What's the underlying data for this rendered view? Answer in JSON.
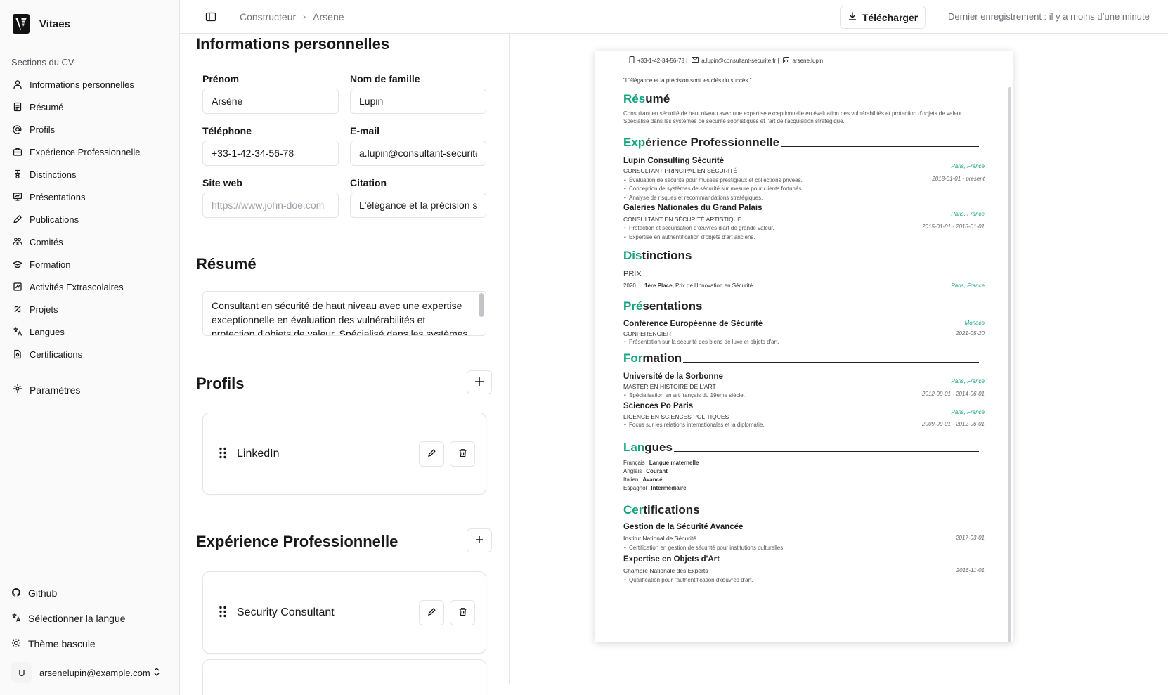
{
  "app": {
    "name": "Vitaes"
  },
  "sidebar": {
    "section_label": "Sections du CV",
    "items": [
      {
        "label": "Informations personnelles",
        "icon": "user-icon"
      },
      {
        "label": "Résumé",
        "icon": "document-icon"
      },
      {
        "label": "Profils",
        "icon": "at-icon"
      },
      {
        "label": "Expérience Professionnelle",
        "icon": "briefcase-icon"
      },
      {
        "label": "Distinctions",
        "icon": "award-icon"
      },
      {
        "label": "Présentations",
        "icon": "presentation-icon"
      },
      {
        "label": "Publications",
        "icon": "pen-icon"
      },
      {
        "label": "Comités",
        "icon": "users-icon"
      },
      {
        "label": "Formation",
        "icon": "graduation-cap-icon"
      },
      {
        "label": "Activités Extrascolaires",
        "icon": "activity-icon"
      },
      {
        "label": "Projets",
        "icon": "projects-icon"
      },
      {
        "label": "Langues",
        "icon": "languages-icon"
      },
      {
        "label": "Certifications",
        "icon": "certificate-icon"
      }
    ],
    "settings_label": "Paramètres",
    "github_label": "Github",
    "language_label": "Sélectionner la langue",
    "theme_label": "Thème bascule",
    "user": {
      "avatar": "U",
      "email": "arsenelupin@example.com"
    }
  },
  "topbar": {
    "breadcrumb": [
      "Constructeur",
      "Arsene"
    ],
    "download_label": "Télécharger",
    "save_status": "Dernier enregistrement : il y a moins d’une minute"
  },
  "editor": {
    "personal": {
      "title": "Informations personnelles",
      "first_name_label": "Prénom",
      "first_name": "Arsène",
      "last_name_label": "Nom de famille",
      "last_name": "Lupin",
      "phone_label": "Téléphone",
      "phone": "+33-1-42-34-56-78",
      "email_label": "E-mail",
      "email": "a.lupin@consultant-securite.fr",
      "website_label": "Site web",
      "website_placeholder": "https://www.john-doe.com",
      "quote_label": "Citation",
      "quote": "L'élégance et la précision sont les clés du succès."
    },
    "summary": {
      "title": "Résumé",
      "text": "Consultant en sécurité de haut niveau avec une expertise exceptionnelle en évaluation des vulnérabilités et protection d'objets de valeur. Spécialisé dans les systèmes de sécurité sophistiqués et l'art de l'acquisition stratégique."
    },
    "profiles": {
      "title": "Profils",
      "items": [
        {
          "label": "LinkedIn"
        }
      ]
    },
    "experience": {
      "title": "Expérience Professionnelle",
      "items": [
        {
          "label": "Security Consultant"
        }
      ]
    }
  },
  "preview": {
    "contact": {
      "phone": "+33-1-42-34-56-78 |",
      "email": "a.lupin@consultant-securite.fr |",
      "linkedin": "arsene.lupin"
    },
    "quote": "\"L'élégance et la précision sont les clés du succès.\"",
    "summary": {
      "h_acc": "Rés",
      "h_rest": "umé",
      "text": "Consultant en sécurité de haut niveau avec une expertise exceptionnelle en évaluation des vulnérabilités et protection d'objets de valeur. Spécialisé dans les systèmes de sécurité sophistiqués et l'art de l'acquisition stratégique."
    },
    "experience": {
      "h_acc": "Exp",
      "h_rest": "érience Professionnelle",
      "items": [
        {
          "org": "Lupin Consulting Sécurité",
          "loc": "Paris, France",
          "role": "CONSULTANT PRINCIPAL EN SÉCURITÉ",
          "date": "2018-01-01 - present",
          "bullets": [
            "Évaluation de sécurité pour musées prestigieux et collections privées.",
            "Conception de systèmes de sécurité sur mesure pour clients fortunés.",
            "Analyse de risques et recommandations stratégiques."
          ]
        },
        {
          "org": "Galeries Nationales du Grand Palais",
          "loc": "Paris, France",
          "role": "CONSULTANT EN SÉCURITÉ ARTISTIQUE",
          "date": "2015-01-01 - 2018-01-01",
          "bullets": [
            "Protection et sécurisation d'œuvres d'art de grande valeur.",
            "Expertise en authentification d'objets d'art anciens."
          ]
        }
      ]
    },
    "awards": {
      "h_acc": "Dis",
      "h_rest": "tinctions",
      "category": "PRIX",
      "year": "2020",
      "place": "1ère Place,",
      "name": "Prix de l'Innovation en Sécurité",
      "loc": "Paris, France"
    },
    "presentations": {
      "h_acc": "Pré",
      "h_rest": "sentations",
      "title": "Conférence Européenne de Sécurité",
      "loc": "Monaco",
      "role": "CONFERENCIER",
      "date": "2021-05-20",
      "bullet": "Présentation sur la sécurité des biens de luxe et objets d'art."
    },
    "education": {
      "h_acc": "For",
      "h_rest": "mation",
      "items": [
        {
          "school": "Université de la Sorbonne",
          "loc": "Paris, France",
          "degree": "MASTER EN HISTOIRE DE L'ART",
          "date": "2012-09-01 - 2014-06-01",
          "bullet": "Spécialisation en art français du 19ème siècle."
        },
        {
          "school": "Sciences Po Paris",
          "loc": "Paris, France",
          "degree": "LICENCE EN SCIENCES POLITIQUES",
          "date": "2009-09-01 - 2012-06-01",
          "bullet": "Focus sur les relations internationales et la diplomatie."
        }
      ]
    },
    "languages": {
      "h_acc": "Lan",
      "h_rest": "gues",
      "items": [
        {
          "lang": "Français",
          "level": "Langue maternelle"
        },
        {
          "lang": "Anglais",
          "level": "Courant"
        },
        {
          "lang": "Italien",
          "level": "Avancé"
        },
        {
          "lang": "Espagnol",
          "level": "Intermédiaire"
        }
      ]
    },
    "certifications": {
      "h_acc": "Cer",
      "h_rest": "tifications",
      "items": [
        {
          "title": "Gestion de la Sécurité Avancée",
          "issuer": "Institut National de Sécurité",
          "date": "2017-03-01",
          "bullet": "Certification en gestion de sécurité pour institutions culturelles."
        },
        {
          "title": "Expertise en Objets d'Art",
          "issuer": "Chambre Nationale des Experts",
          "date": "2016-11-01",
          "bullet": "Qualification pour l'authentification d'œuvres d'art."
        }
      ]
    },
    "accent_color": "#11a37f"
  }
}
